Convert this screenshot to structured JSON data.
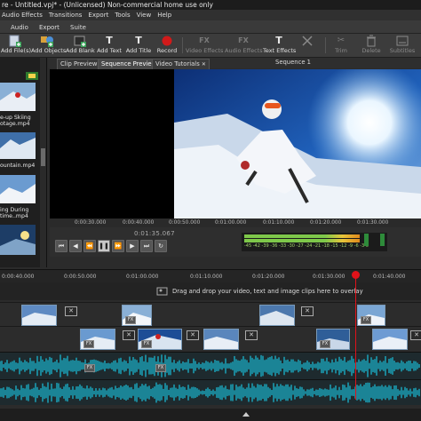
{
  "window": {
    "title": "re - Untitled.vpj* - (Unlicensed) Non-commercial home use only"
  },
  "menu": [
    "Audio Effects",
    "Transitions",
    "Export",
    "Tools",
    "View",
    "Help"
  ],
  "ribbon_tabs": [
    "Audio",
    "Export",
    "Suite"
  ],
  "toolbar": {
    "add_files": "Add File(s)",
    "add_objects": "Add Objects",
    "add_blank": "Add Blank",
    "add_text": "Add Text",
    "add_title": "Add Title",
    "record": "Record",
    "video_effects": "Video Effects",
    "audio_effects": "Audio Effects",
    "text_effects": "Text Effects",
    "trim": "Trim",
    "delete": "Delete",
    "subtitles": "Subtitles",
    "icons": {
      "add_text": "T",
      "add_title": "T",
      "text_effects": "T",
      "trim": "✂",
      "delete": "🗑",
      "video_effects": "FX",
      "audio_effects": "FX"
    }
  },
  "bin": {
    "clips": [
      {
        "label_lines": [
          "e-up Skiing",
          "otage.mp4"
        ]
      },
      {
        "label_lines": [
          "ountain.mp4"
        ]
      },
      {
        "label_lines": [
          "ing During",
          "time..mp4"
        ]
      }
    ]
  },
  "sequence": {
    "tabs": [
      "Clip Preview",
      "Sequence Preview",
      "Video Tutorials"
    ],
    "close_glyph": "✕",
    "title": "Sequence 1",
    "preview_ruler": [
      "0:00:30.000",
      "0:00:40.000",
      "0:00:50.000",
      "0:01:00.000",
      "0:01:10.000",
      "0:01:20.000",
      "0:01:30.000"
    ],
    "timecode": "0:01:35.067"
  },
  "meter": {
    "scale": "-45 -42 -39 -36 -33 -30 -27 -24 -21 -18 -15 -12 -9 -6 -3 0"
  },
  "timeline": {
    "ruler": [
      "0:00:40.000",
      "0:00:50.000",
      "0:01:00.000",
      "0:01:10.000",
      "0:01:20.000",
      "0:01:30.000",
      "0:01:40.000"
    ],
    "drag_hint": "Drag and drop your video, text and image clips here to overlay",
    "fx_label": "FX",
    "x_label": "✕"
  },
  "colors": {
    "waveform": "#1aa3b8",
    "playhead": "#e0121a",
    "record": "#d11a1a",
    "meter_green": "#7ec84a",
    "meter_orange": "#e08a1c"
  }
}
